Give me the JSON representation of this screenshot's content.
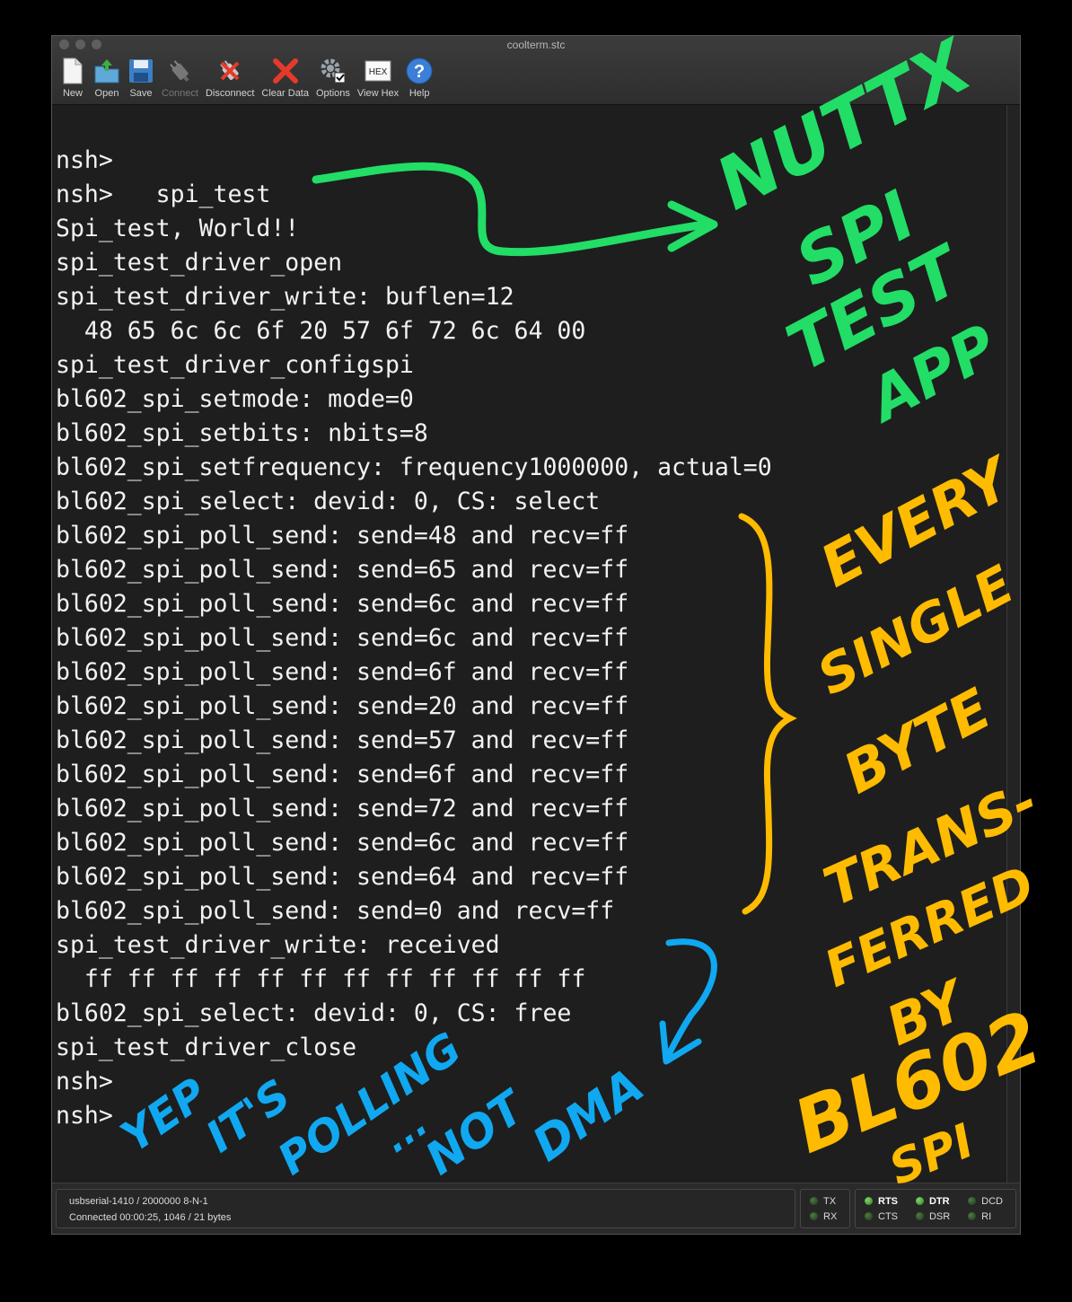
{
  "window": {
    "title": "coolterm.stc"
  },
  "toolbar": {
    "new": "New",
    "open": "Open",
    "save": "Save",
    "connect": "Connect",
    "disconnect": "Disconnect",
    "clear": "Clear Data",
    "options": "Options",
    "view_hex": "View Hex",
    "help": "Help",
    "hex_icon_text": "HEX",
    "help_icon_text": "?"
  },
  "terminal": {
    "lines": [
      "nsh>",
      "nsh>   spi_test",
      "Spi_test, World!!",
      "spi_test_driver_open",
      "spi_test_driver_write: buflen=12",
      "  48 65 6c 6c 6f 20 57 6f 72 6c 64 00",
      "spi_test_driver_configspi",
      "bl602_spi_setmode: mode=0",
      "bl602_spi_setbits: nbits=8",
      "bl602_spi_setfrequency: frequency1000000, actual=0",
      "bl602_spi_select: devid: 0, CS: select",
      "bl602_spi_poll_send: send=48 and recv=ff",
      "bl602_spi_poll_send: send=65 and recv=ff",
      "bl602_spi_poll_send: send=6c and recv=ff",
      "bl602_spi_poll_send: send=6c and recv=ff",
      "bl602_spi_poll_send: send=6f and recv=ff",
      "bl602_spi_poll_send: send=20 and recv=ff",
      "bl602_spi_poll_send: send=57 and recv=ff",
      "bl602_spi_poll_send: send=6f and recv=ff",
      "bl602_spi_poll_send: send=72 and recv=ff",
      "bl602_spi_poll_send: send=6c and recv=ff",
      "bl602_spi_poll_send: send=64 and recv=ff",
      "bl602_spi_poll_send: send=0 and recv=ff",
      "spi_test_driver_write: received",
      "  ff ff ff ff ff ff ff ff ff ff ff ff",
      "bl602_spi_select: devid: 0, CS: free",
      "spi_test_driver_close",
      "nsh>",
      "nsh>"
    ]
  },
  "status": {
    "port": "usbserial-1410 / 2000000 8-N-1",
    "connection": "Connected 00:00:25, 1046 / 21 bytes",
    "leds": {
      "tx": "TX",
      "rx": "RX",
      "rts": "RTS",
      "cts": "CTS",
      "dtr": "DTR",
      "dsr": "DSR",
      "dcd": "DCD",
      "ri": "RI"
    }
  },
  "annotations": {
    "green": [
      "NUTTX",
      "SPI",
      "TEST",
      "APP"
    ],
    "orange": [
      "EVERY",
      "SINGLE",
      "BYTE",
      "TRANS-",
      "FERRED",
      "BY",
      "BL602",
      "SPI"
    ],
    "blue": [
      "YEP",
      "IT'S",
      "POLLING",
      "...",
      "NOT",
      "DMA"
    ],
    "colors": {
      "green": "#22dd66",
      "orange": "#ffbb00",
      "blue": "#10a8f0"
    }
  }
}
